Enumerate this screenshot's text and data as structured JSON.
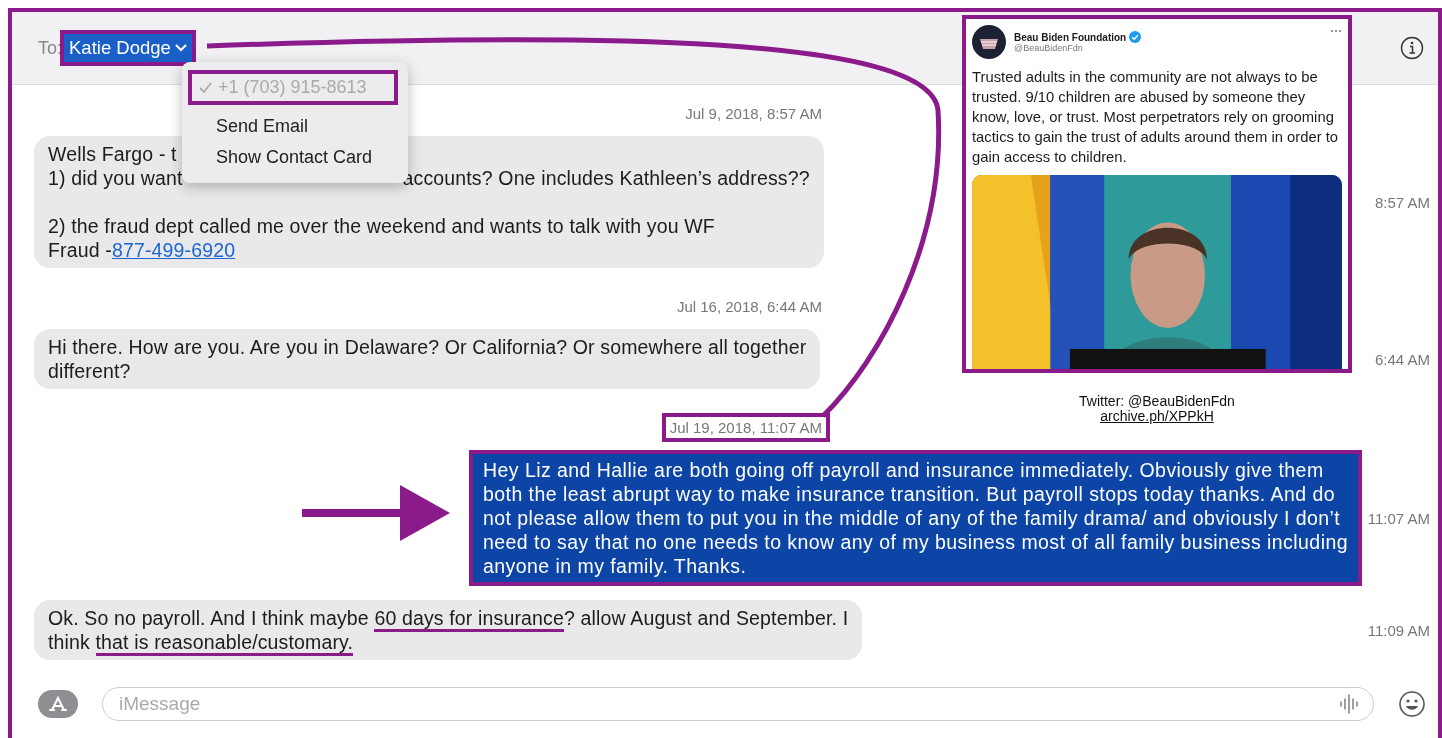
{
  "header": {
    "to_label": "To:",
    "recipient": {
      "name": "Katie Dodge",
      "highlighted": true
    }
  },
  "contact_menu": {
    "items": [
      {
        "label": "+1 (703) 915-8613",
        "checked": true,
        "disabled": true,
        "highlighted": true
      },
      {
        "label": "Send Email",
        "checked": false,
        "disabled": false,
        "highlighted": false
      },
      {
        "label": "Show Contact Card",
        "checked": false,
        "disabled": false,
        "highlighted": false
      }
    ]
  },
  "conversation": [
    {
      "kind": "timestamp",
      "text": "Jul 9, 2018, 8:57 AM",
      "highlighted": false
    },
    {
      "kind": "incoming",
      "time": "8:57 AM",
      "highlighted": false,
      "paragraphs": [
        [
          [
            {
              "kind": "plain",
              "text": "Wells Fargo - t"
            }
          ],
          [
            {
              "kind": "plain",
              "text": "1) did you want"
            },
            {
              "kind": "after_cover",
              "text": "accounts? One includes Kathleen’s address??"
            }
          ]
        ],
        [
          [
            {
              "kind": "plain",
              "text": "2) the fraud dept called me over the weekend and wants to talk with you WF"
            }
          ],
          [
            {
              "kind": "plain",
              "text": "Fraud -"
            },
            {
              "kind": "link",
              "text": "877-499-6920"
            }
          ]
        ]
      ]
    },
    {
      "kind": "timestamp",
      "text": "Jul 16, 2018, 6:44 AM",
      "highlighted": false
    },
    {
      "kind": "incoming",
      "time": "6:44 AM",
      "highlighted": false,
      "paragraphs": [
        [
          [
            {
              "kind": "plain",
              "text": "Hi there. How are you. Are you in Delaware? Or California? Or somewhere all together"
            }
          ],
          [
            {
              "kind": "plain",
              "text": "different?"
            }
          ]
        ]
      ]
    },
    {
      "kind": "timestamp",
      "text": "Jul 19, 2018, 11:07 AM",
      "highlighted": true
    },
    {
      "kind": "outgoing",
      "time": "11:07 AM",
      "highlighted": true,
      "paragraphs": [
        [
          [
            {
              "kind": "plain",
              "text": "Hey Liz and Hallie are both going off payroll and insurance immediately. Obviously give them"
            }
          ],
          [
            {
              "kind": "plain",
              "text": "both the least abrupt way to make insurance transition. But payroll stops today thanks. And do"
            }
          ],
          [
            {
              "kind": "plain",
              "text": "not please allow them to put you in the middle of any of the family drama/ and obviously I don’t"
            }
          ],
          [
            {
              "kind": "plain",
              "text": "need to say that no one needs to know any of my business most of all family business including"
            }
          ],
          [
            {
              "kind": "plain",
              "text": "anyone in my family. Thanks."
            }
          ]
        ]
      ]
    },
    {
      "kind": "incoming",
      "time": "11:09 AM",
      "highlighted": false,
      "paragraphs": [
        [
          [
            {
              "kind": "plain",
              "text": "Ok. So no payroll. And I think maybe "
            },
            {
              "kind": "underlined",
              "text": "60 days for insurance"
            },
            {
              "kind": "plain",
              "text": "? allow August and September. I"
            }
          ],
          [
            {
              "kind": "plain",
              "text": "think "
            },
            {
              "kind": "underlined",
              "text": "that is reasonable/customary."
            }
          ]
        ]
      ]
    }
  ],
  "composer": {
    "placeholder": "iMessage"
  },
  "tweet": {
    "name": "Beau Biden Foundation",
    "verified": true,
    "handle": "@BeauBidenFdn",
    "text": "Trusted adults in the community are not always to be trusted. 9/10 children are abused by someone they know, love, or trust. Most perpetrators rely on grooming tactics to gain the trust of adults around them in order to gain access to children."
  },
  "source_caption": {
    "text": "Twitter: @BeauBidenFdn",
    "link": "archive.ph/XPPkH"
  }
}
